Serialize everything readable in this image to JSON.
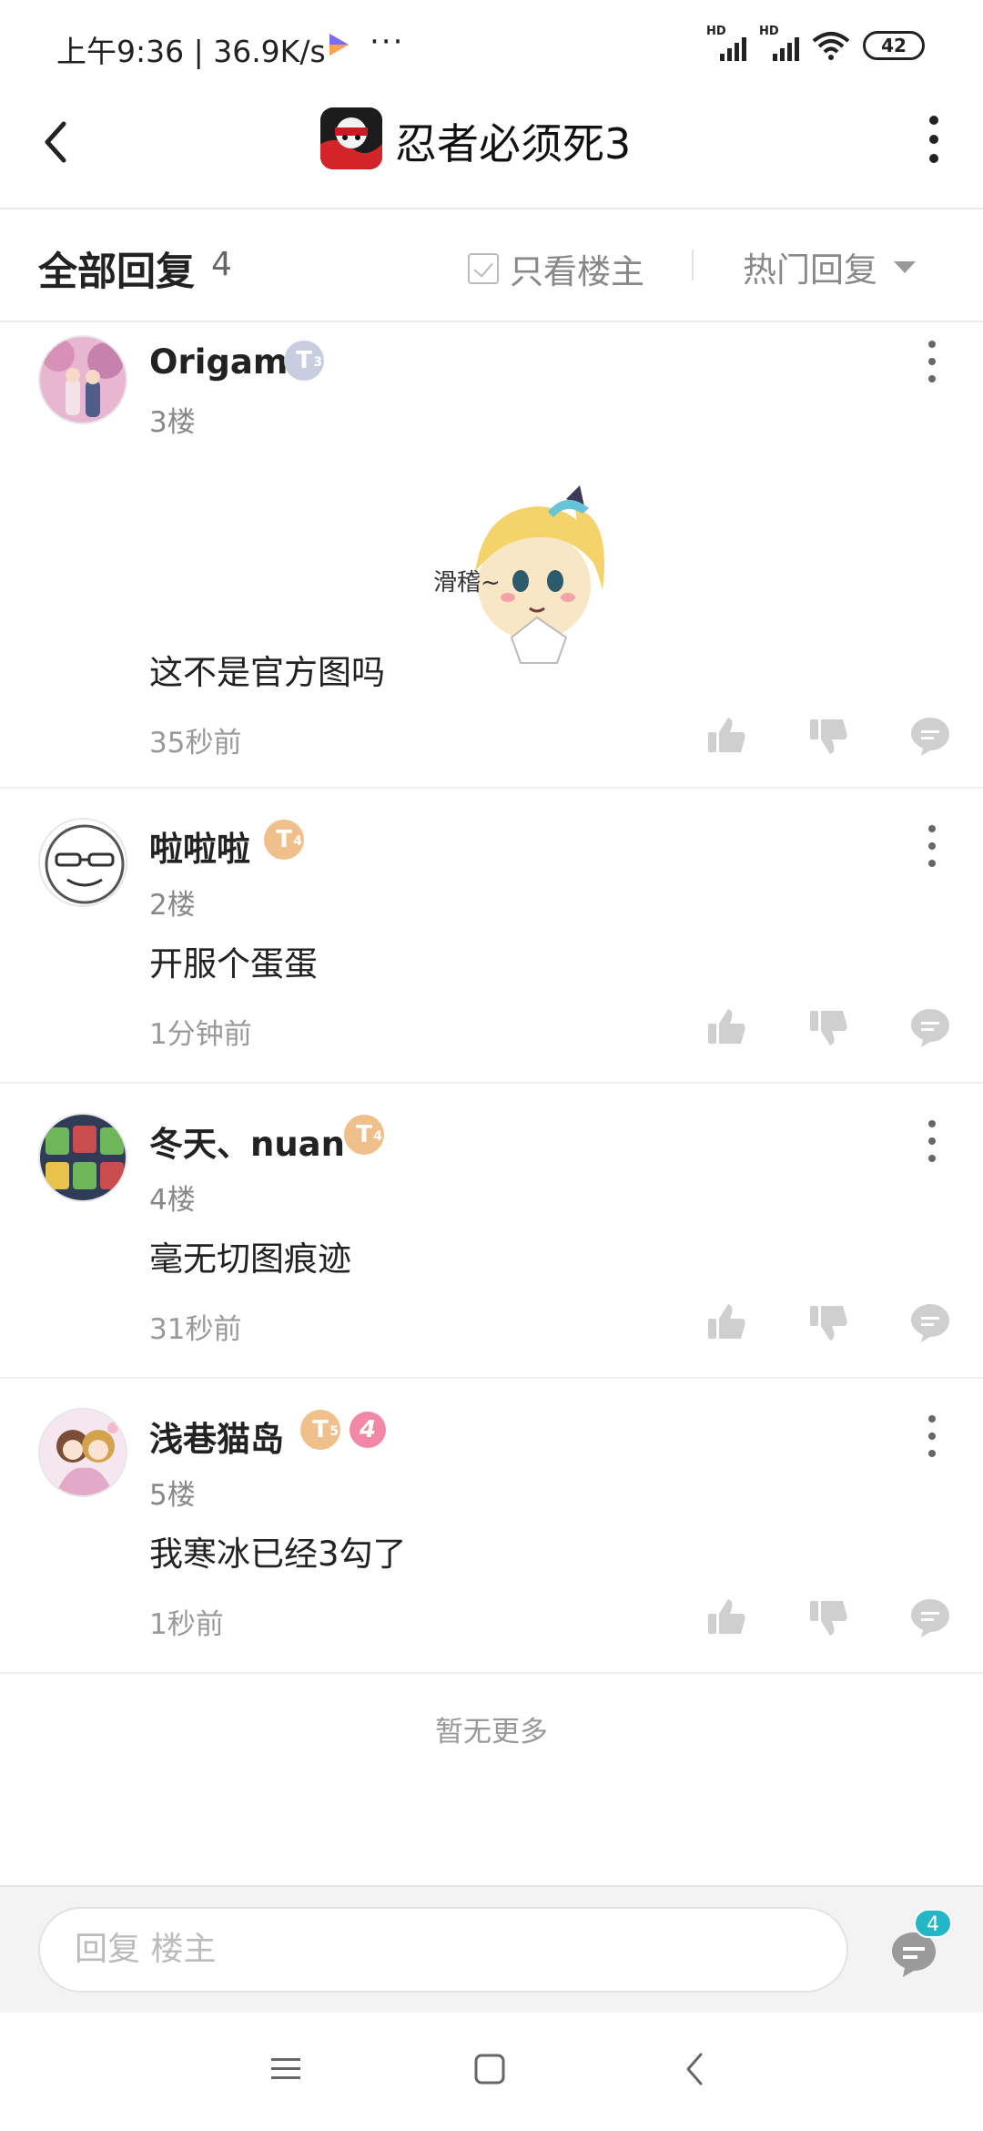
{
  "status_bar": {
    "time": "上午9:36 | 36.9K/s",
    "more": "···",
    "battery": "42",
    "hd_label": "HD",
    "icons": [
      "signal-icon",
      "signal-icon",
      "wifi-icon",
      "battery-icon"
    ]
  },
  "header": {
    "title": "忍者必须死3",
    "icons": [
      "back-icon",
      "game-icon",
      "more-icon"
    ]
  },
  "reply_header": {
    "title": "全部回复",
    "count": "4",
    "only_owner_label": "只看楼主",
    "sort_label": "热门回复"
  },
  "comments": [
    {
      "username": "Origami",
      "badge": "T",
      "badge_level": "3",
      "badge_style": "silver",
      "floor": "3楼",
      "text": "这不是官方图吗",
      "time": "35秒前"
    },
    {
      "username": "啦啦啦",
      "badge": "T",
      "badge_level": "4",
      "badge_style": "gold",
      "floor": "2楼",
      "text": "开服个蛋蛋",
      "time": "1分钟前"
    },
    {
      "username": "冬天、nuan",
      "badge": "T",
      "badge_level": "4",
      "badge_style": "gold",
      "floor": "4楼",
      "text": "毫无切图痕迹",
      "time": "31秒前"
    },
    {
      "username": "浅巷猫岛",
      "badge": "T",
      "badge_level": "5",
      "badge_style": "gold",
      "extra_badge": "4",
      "floor": "5楼",
      "text": "我寒冰已经3勾了",
      "time": "1秒前"
    }
  ],
  "sticker": {
    "text": "滑稽~"
  },
  "footer": {
    "no_more": "暂无更多",
    "reply_placeholder": "回复  楼主",
    "comment_count": "4"
  },
  "colors": {
    "accent": "#22b6c6",
    "badge_gold": "#f0c08c",
    "badge_silver": "#c9cde0",
    "badge_pink": "#f387a8"
  }
}
